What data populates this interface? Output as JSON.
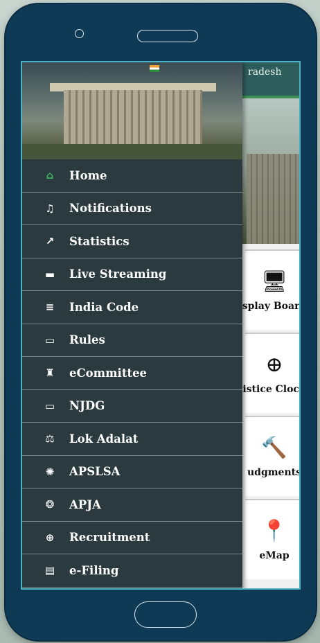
{
  "background": {
    "header_text": "radesh",
    "cards": [
      {
        "label": "splay Board",
        "icon": "monitor-icon"
      },
      {
        "label": "istice Clock",
        "icon": "clock-icon"
      },
      {
        "label": "udgments",
        "icon": "gavel-icon"
      },
      {
        "label": "eMap",
        "icon": "map-pin-icon"
      }
    ]
  },
  "menu": {
    "items": [
      {
        "label": "Home",
        "icon": "home-icon",
        "glyph": "⌂"
      },
      {
        "label": "Notifications",
        "icon": "bell-icon",
        "glyph": "🔔"
      },
      {
        "label": "Statistics",
        "icon": "statistics-icon",
        "glyph": "↗"
      },
      {
        "label": "Live Streaming",
        "icon": "live-streaming-icon",
        "glyph": "▬"
      },
      {
        "label": "India Code",
        "icon": "india-code-icon",
        "glyph": "≡"
      },
      {
        "label": "Rules",
        "icon": "rules-icon",
        "glyph": "▭"
      },
      {
        "label": "eCommittee",
        "icon": "ecommittee-icon",
        "glyph": "♜"
      },
      {
        "label": "NJDG",
        "icon": "monitor-icon",
        "glyph": "▭"
      },
      {
        "label": "Lok Adalat",
        "icon": "scales-icon",
        "glyph": "⚖"
      },
      {
        "label": "APSLSA",
        "icon": "apslsa-emblem-icon",
        "glyph": "✺"
      },
      {
        "label": "APJA",
        "icon": "apja-emblem-icon",
        "glyph": "❂"
      },
      {
        "label": "Recruitment",
        "icon": "recruitment-icon",
        "glyph": "⊕"
      },
      {
        "label": "e-Filing",
        "icon": "e-filing-icon",
        "glyph": "▤"
      }
    ]
  },
  "colors": {
    "phone_frame": "#0f3a55",
    "drawer_bg": "#2b3a3f",
    "home_icon": "#3fb56a",
    "screen_border": "#4fb3c8"
  }
}
